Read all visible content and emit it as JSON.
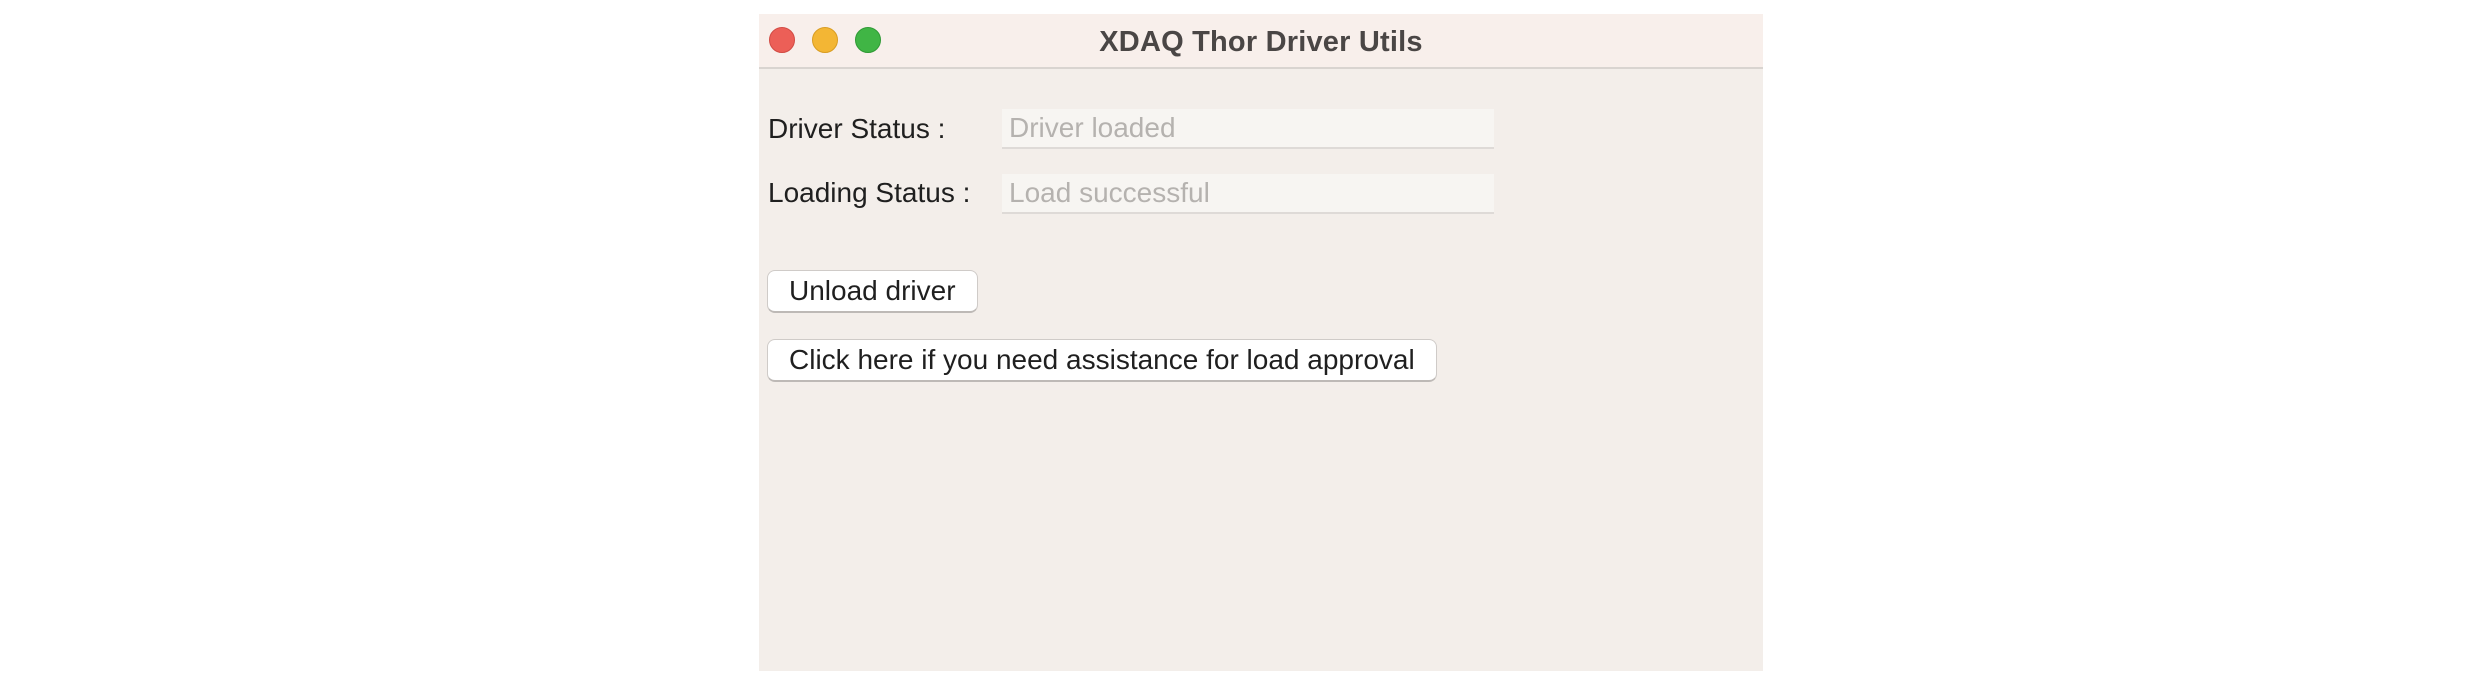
{
  "window": {
    "title": "XDAQ Thor Driver Utils"
  },
  "form": {
    "driver_status_label": "Driver Status :",
    "driver_status_value": "Driver loaded",
    "loading_status_label": "Loading Status :",
    "loading_status_value": "Load successful"
  },
  "actions": {
    "unload_label": "Unload driver",
    "assist_label": "Click here if you need assistance for load approval"
  },
  "colors": {
    "close": "#ec5f57",
    "minimize": "#f3b634",
    "maximize": "#40b545",
    "window_bg": "#f3eeea"
  }
}
